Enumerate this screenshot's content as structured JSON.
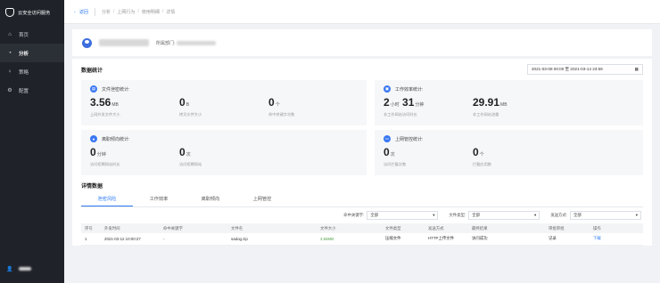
{
  "app": {
    "title": "云安全访问服务"
  },
  "sidebar": {
    "items": [
      {
        "label": "首页",
        "icon": "home-icon"
      },
      {
        "label": "分析",
        "icon": "analytics-icon"
      },
      {
        "label": "策略",
        "icon": "bulb-icon"
      },
      {
        "label": "配置",
        "icon": "gear-icon"
      }
    ],
    "user": {
      "icon": "user-icon"
    }
  },
  "topbar": {
    "back": "返回",
    "breadcrumb": [
      "分析",
      "上网行为",
      "使用明细",
      "详情"
    ]
  },
  "usercard": {
    "dept_label": "所属部门:"
  },
  "stats": {
    "title": "数据统计",
    "date_range": "2021-03-08 00:00 至 2021-03-14 23:59",
    "cards": [
      {
        "title": "文件泄密统计:",
        "icon": "file-icon",
        "metrics": [
          {
            "value": "3.56",
            "unit": "MB",
            "caption": "上网外发文件大小"
          },
          {
            "value": "0",
            "unit": "B",
            "caption": "拷贝文件大小"
          },
          {
            "value": "0",
            "unit": "个",
            "caption": "命中关键字次数"
          }
        ]
      },
      {
        "title": "工作效率统计:",
        "icon": "briefcase-icon",
        "metrics": [
          {
            "value": "2",
            "unit": "小时",
            "value2": "31",
            "unit2": "分钟",
            "caption": "非工作网站访问时长"
          },
          {
            "value": "29.91",
            "unit": "MB",
            "caption": "非工作网站流量"
          }
        ]
      },
      {
        "title": "离职倾向统计:",
        "icon": "person-icon",
        "metrics": [
          {
            "value": "0",
            "unit": "分钟",
            "caption": "访问招聘网站时长"
          },
          {
            "value": "0",
            "unit": "次",
            "caption": "访问招聘网站"
          }
        ]
      },
      {
        "title": "上网管控统计:",
        "icon": "monitor-icon",
        "metrics": [
          {
            "value": "0",
            "unit": "次",
            "caption": "访问拦截次数"
          },
          {
            "value": "0",
            "unit": "个",
            "caption": "拦截应用数"
          }
        ]
      }
    ]
  },
  "details": {
    "title": "详情数据",
    "tabs": [
      "泄密风险",
      "工作效率",
      "离职倾向",
      "上网管控"
    ],
    "filters": [
      {
        "label": "命中关键字:",
        "value": "全部"
      },
      {
        "label": "文件类型:",
        "value": "全部"
      },
      {
        "label": "发送方式:",
        "value": "全部"
      }
    ],
    "columns": [
      "序号",
      "外发时间",
      "命中关键字",
      "文件名",
      "文件大小",
      "文件类型",
      "发送方式",
      "最终结果",
      "审批审批",
      "操作"
    ],
    "rows": [
      [
        "1",
        "2021-03-12 10:00:27",
        "-",
        "sadog.zip",
        "3.56MB",
        "压缩文件",
        "HTTP上传文件",
        "访问成功",
        "记录",
        "下载"
      ]
    ]
  },
  "colors": {
    "accent": "#2f7cf6",
    "sidebar_bg": "#1f2329",
    "success": "#52a34a"
  }
}
